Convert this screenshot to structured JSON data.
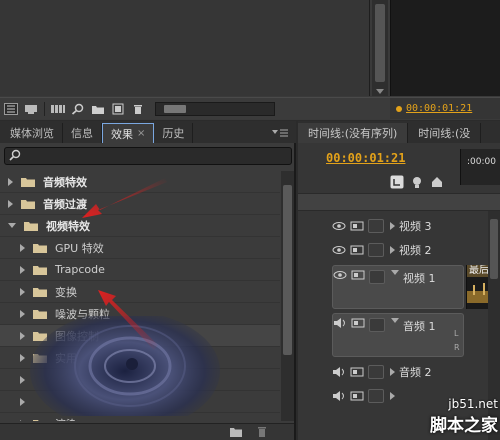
{
  "monitor": {
    "timecode": "00:00:01:21"
  },
  "panel_tabs": [
    {
      "label": "媒体浏览"
    },
    {
      "label": "信息"
    },
    {
      "label": "效果",
      "close": "×"
    },
    {
      "label": "历史"
    }
  ],
  "search": {
    "value": ""
  },
  "effects_tree": [
    {
      "label": "音频特效"
    },
    {
      "label": "音频过渡"
    },
    {
      "label": "视频特效"
    },
    {
      "label": "GPU 特效"
    },
    {
      "label": "Trapcode"
    },
    {
      "label": "变换"
    },
    {
      "label": "噪波与颗粒"
    },
    {
      "label": "图像控制"
    },
    {
      "label": "实用"
    },
    {
      "label": ""
    },
    {
      "label": ""
    },
    {
      "label": ""
    },
    {
      "label": "渲染"
    }
  ],
  "timeline": {
    "tabs": [
      {
        "label": "时间线:(没有序列)"
      },
      {
        "label": "时间线:(没"
      }
    ],
    "timecode": "00:00:01:21",
    "ruler_time": ":00:00",
    "tracks": [
      {
        "name": "视频 3"
      },
      {
        "name": "视频 2"
      },
      {
        "name": "视频 1"
      },
      {
        "name": "音频 1"
      },
      {
        "name": "音频 2"
      },
      {
        "name": ""
      }
    ],
    "clip_title": "最后一",
    "audio_channels": [
      "L",
      "R"
    ]
  },
  "watermark": {
    "domain": "jb51.net",
    "name": "脚本之家"
  },
  "colors": {
    "accent": "#e3a21a",
    "arrow": "#e02020"
  }
}
